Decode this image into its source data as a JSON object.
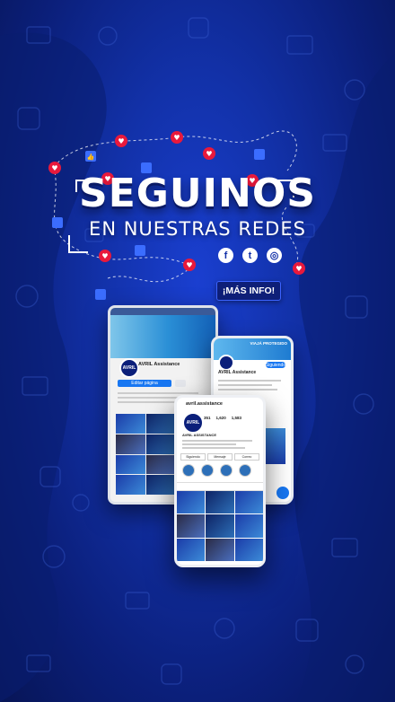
{
  "headline": {
    "title": "SEGUINOS",
    "subtitle": "EN NUESTRAS REDES"
  },
  "social_icons": [
    {
      "icon": "facebook-icon",
      "glyph": "f"
    },
    {
      "icon": "twitter-icon",
      "glyph": "t"
    },
    {
      "icon": "instagram-icon",
      "glyph": "◎"
    }
  ],
  "cta": {
    "label": "¡MÁS INFO!"
  },
  "facebook_page": {
    "name": "AVRIL Assistance",
    "manage_button": "Editar página"
  },
  "twitter_profile": {
    "name": "AVRIL Assistance",
    "follow_button": "Siguiendo",
    "cover_text": "VIAJÁ PROTEGIDO"
  },
  "instagram_profile": {
    "username": "avril.assistance",
    "display_name": "AVRIL ASSISTANCE",
    "stats": [
      {
        "value": "351",
        "label": "Publicaciones"
      },
      {
        "value": "1,620",
        "label": "Seguidores"
      },
      {
        "value": "1,583",
        "label": "Seguidos"
      }
    ],
    "buttons": [
      "Siguiendo",
      "Mensaje",
      "Correo"
    ]
  },
  "colors": {
    "background": "#1231a8",
    "accent_blue": "#1877f2",
    "heart_red": "#e8193c",
    "like_blue": "#3b6dff"
  }
}
